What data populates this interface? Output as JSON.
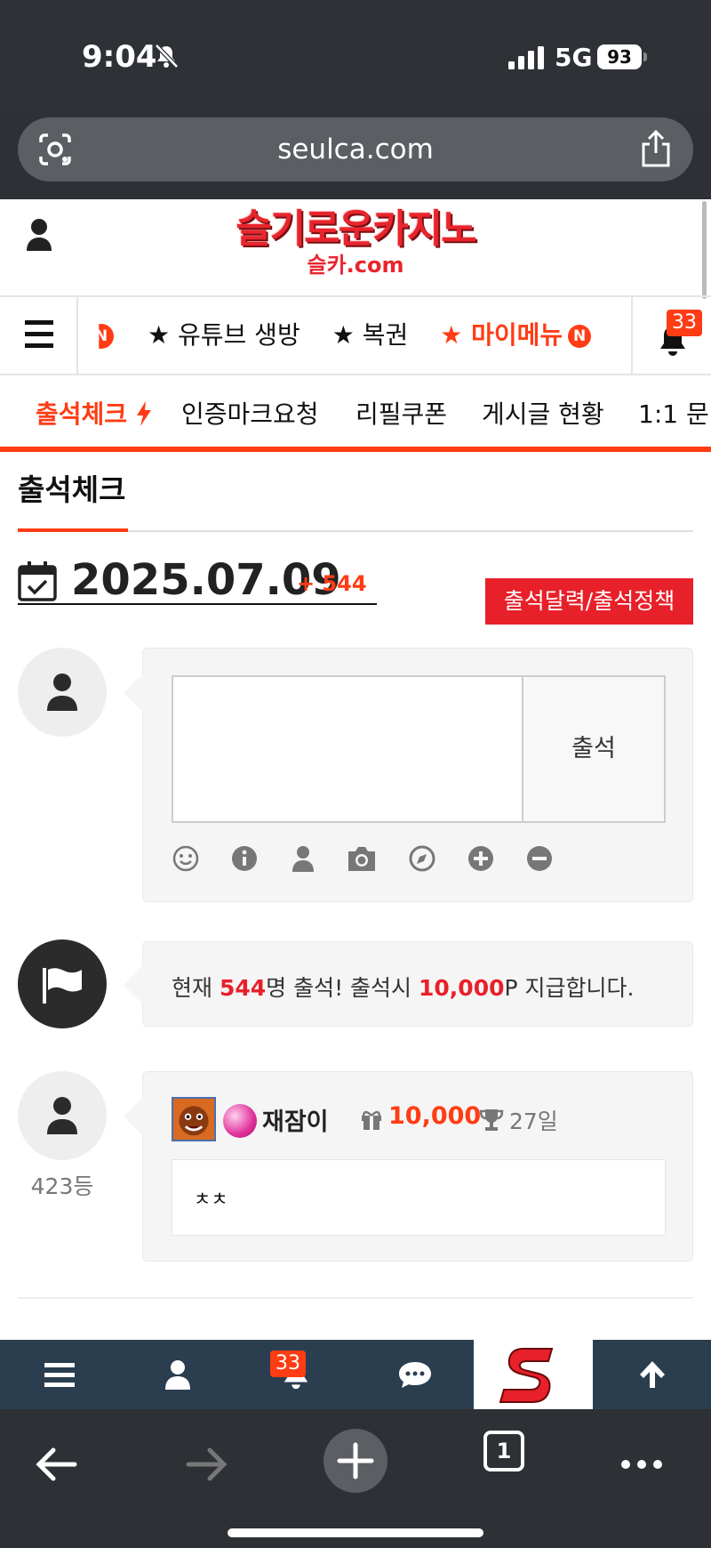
{
  "status_bar": {
    "time": "9:04",
    "network": "5G",
    "battery": "93"
  },
  "browser": {
    "url": "seulca.com",
    "tab_count": "1"
  },
  "site": {
    "logo_main": "슬기로운카지노",
    "logo_sub": "슬카.com",
    "menu": {
      "items": [
        "★ 유튜브 생방",
        "★ 복권",
        "★ 마이메뉴"
      ],
      "new_badge": "N",
      "notification_count": "33"
    },
    "sub_tabs": [
      "출석체크",
      "인증마크요청",
      "리필쿠폰",
      "게시글 현황",
      "1:1 문"
    ]
  },
  "attendance": {
    "title": "출석체크",
    "date": "2025.07.09",
    "date_delta": "+ 544",
    "policy_button": "출석달력/출석정책",
    "submit_label": "출석",
    "notice": {
      "prefix": "현재 ",
      "count": "544",
      "middle": "명 출석! 출석시 ",
      "reward": "10,000",
      "suffix": "P 지급합니다."
    },
    "entry": {
      "rank": "423등",
      "nickname": "재잠이",
      "points": "10,000",
      "streak": "27일",
      "comment": "ㅊㅊ"
    }
  },
  "site_nav": {
    "notification_count": "33"
  },
  "colors": {
    "accent": "#ff3c14",
    "red": "#e8202a",
    "nav_bg": "#2b3e50"
  }
}
